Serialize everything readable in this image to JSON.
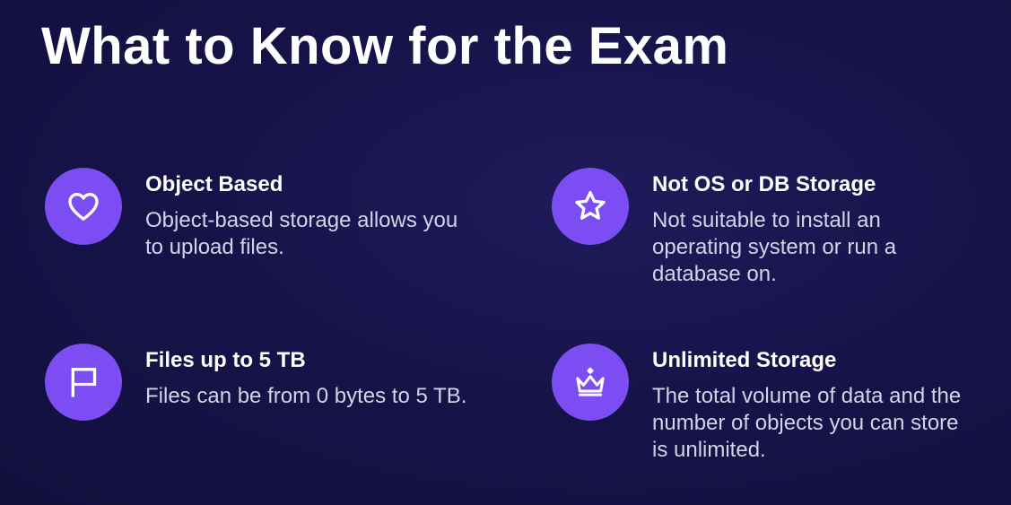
{
  "title": "What to Know for the Exam",
  "colors": {
    "background": "#17134a",
    "icon_circle": "#7b4df2",
    "title_text": "#ffffff",
    "desc_text": "#d4d2e6"
  },
  "cards": [
    {
      "icon": "heart-icon",
      "title": "Object Based",
      "description": "Object-based storage allows you to upload files."
    },
    {
      "icon": "star-icon",
      "title": "Not OS or DB Storage",
      "description": "Not suitable to install an operating system or run a database on."
    },
    {
      "icon": "flag-icon",
      "title": "Files up to 5 TB",
      "description": "Files can be from 0 bytes to 5 TB."
    },
    {
      "icon": "crown-icon",
      "title": "Unlimited Storage",
      "description": "The total volume of data and the number of objects you can store is unlimited."
    }
  ]
}
